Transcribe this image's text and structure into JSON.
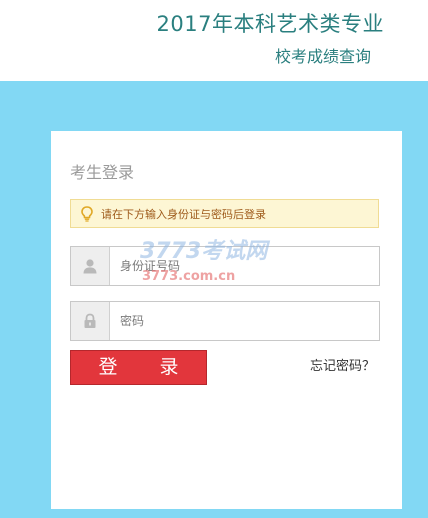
{
  "header": {
    "title": "2017年本科艺术类专业",
    "subtitle": "校考成绩查询"
  },
  "login": {
    "heading": "考生登录",
    "notice": "请在下方输入身份证与密码后登录",
    "id_field": {
      "placeholder": "身份证号码",
      "value": ""
    },
    "password_field": {
      "placeholder": "密码",
      "value": ""
    },
    "submit_label": "登 录",
    "forgot_label": "忘记密码？"
  },
  "watermark": {
    "line1": "3773考试网",
    "line2": "3773.com.cn"
  },
  "icons": {
    "notice": "lightbulb-icon",
    "id_field": "user-icon",
    "password_field": "lock-icon"
  },
  "colors": {
    "background": "#82d8f4",
    "title": "#2a7f7f",
    "button": "#e2363c",
    "notice_bg": "#fdf6d4",
    "notice_text": "#9e5a1a"
  }
}
